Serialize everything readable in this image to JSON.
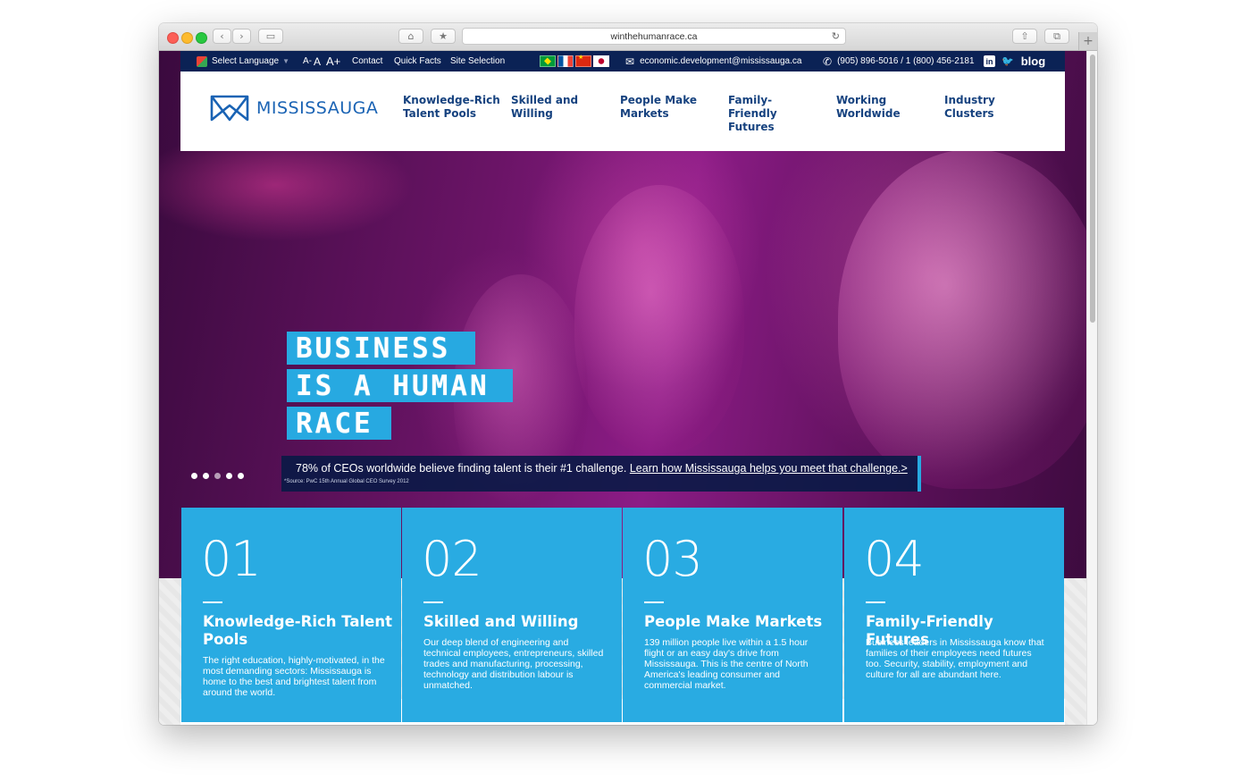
{
  "browser": {
    "url": "winthehumanrace.ca",
    "buttons": {
      "back": "‹",
      "forward": "›",
      "sidebar": "▭",
      "home": "⌂",
      "bookmark": "★",
      "reload": "↻",
      "share": "⇧",
      "tabs": "⧉",
      "new_tab": "+"
    }
  },
  "topbar": {
    "language": "Select Language",
    "language_arrow": "▼",
    "text_size": {
      "small": "A-",
      "normal": "A",
      "large": "A+"
    },
    "contact": "Contact",
    "quick_facts": "Quick Facts",
    "site_selection": "Site Selection",
    "email_icon": "✉",
    "email": "economic.development@mississauga.ca",
    "phone_icon": "✆",
    "phone": "(905) 896-5016 / 1 (800) 456-2181",
    "linkedin": "in",
    "twitter": "🐦",
    "blog": "blog"
  },
  "header": {
    "logo_text": "MISSISSAUGA",
    "nav": [
      {
        "label": "Knowledge-Rich Talent Pools"
      },
      {
        "label": "Skilled and Willing"
      },
      {
        "label": "People Make Markets"
      },
      {
        "label": "Family-Friendly Futures"
      },
      {
        "label": "Working Worldwide"
      },
      {
        "label": "Industry Clusters"
      }
    ]
  },
  "hero": {
    "tagline": [
      "BUSINESS",
      "IS A HUMAN",
      "RACE"
    ],
    "caption_text": "78% of CEOs worldwide believe finding talent is their #1 challenge.",
    "caption_link": "Learn how Mississauga helps you meet that challenge.>",
    "source": "*Source: PwC 15th Annual Global CEO Survey 2012"
  },
  "cards": [
    {
      "number": "01",
      "title": "Knowledge-Rich Talent Pools",
      "desc": "The right education, highly-motivated, in the most demanding sectors: Mississauga is home to the best and brightest talent from around the world."
    },
    {
      "number": "02",
      "title": "Skilled and Willing",
      "desc": "Our deep blend of engineering and technical employees, entrepreneurs, skilled trades and manufacturing, processing, technology and distribution labour is unmatched."
    },
    {
      "number": "03",
      "title": "People Make Markets",
      "desc": "139 million people live within a 1.5 hour flight or an easy day's drive from Mississauga. This is the centre of North America's leading consumer and commercial market."
    },
    {
      "number": "04",
      "title": "Family-Friendly Futures",
      "desc": "Business leaders in Mississauga know that families of their employees need futures too. Security, stability, employment and culture for all are abundant here."
    }
  ],
  "colors": {
    "topbar": "#0b2255",
    "nav_text": "#16427f",
    "logo": "#1a63b4",
    "accent_blue": "#29abe2",
    "hero_magenta": "#8c1c86"
  }
}
